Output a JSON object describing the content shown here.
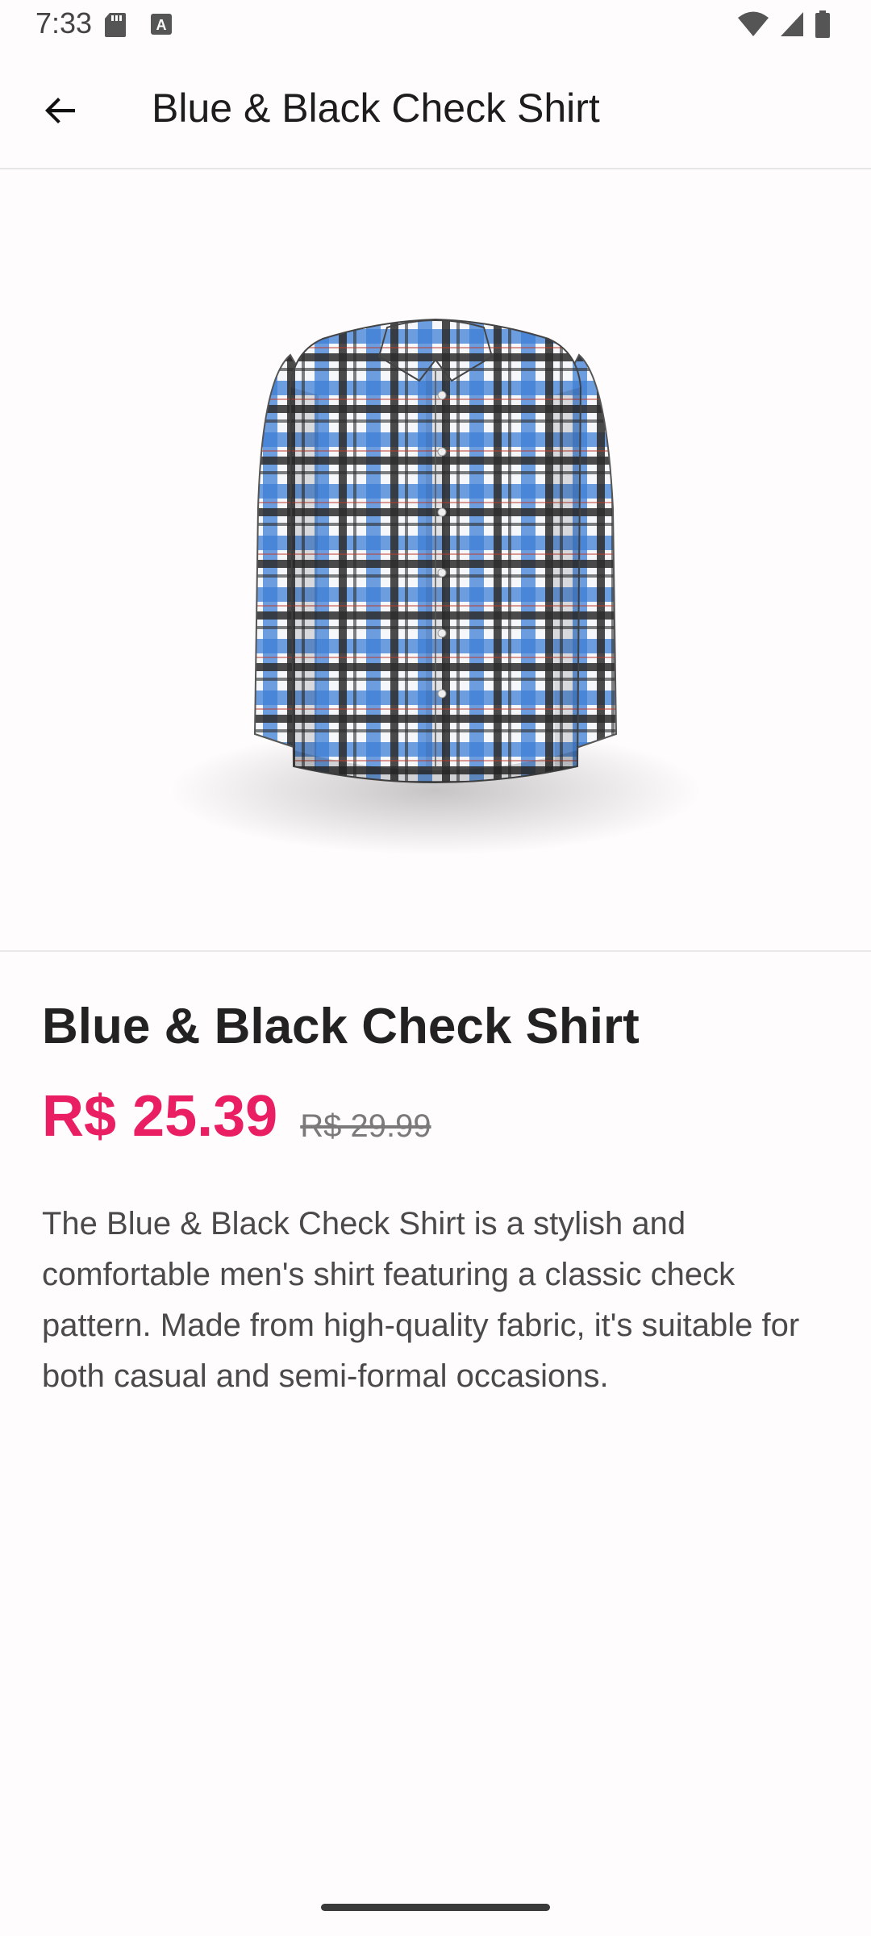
{
  "status_bar": {
    "time": "7:33",
    "icons": [
      "sd-card-icon",
      "keyboard-a-icon",
      "wifi-icon",
      "signal-icon",
      "battery-icon"
    ]
  },
  "app_bar": {
    "back_icon": "arrow-back-icon",
    "title": "Blue & Black Check Shirt"
  },
  "product": {
    "image_alt": "blue-black-check-shirt-image",
    "title": "Blue & Black Check Shirt",
    "price": "R$ 25.39",
    "original_price": "R$ 29.99",
    "description": "The Blue & Black Check Shirt is a stylish and comfortable men's shirt featuring a classic check pattern. Made from high-quality fabric, it's suitable for both casual and semi-formal occasions."
  },
  "colors": {
    "price_accent": "#e91e63",
    "shirt_blue": "#3f7fd4",
    "shirt_black": "#2b2b2b"
  }
}
